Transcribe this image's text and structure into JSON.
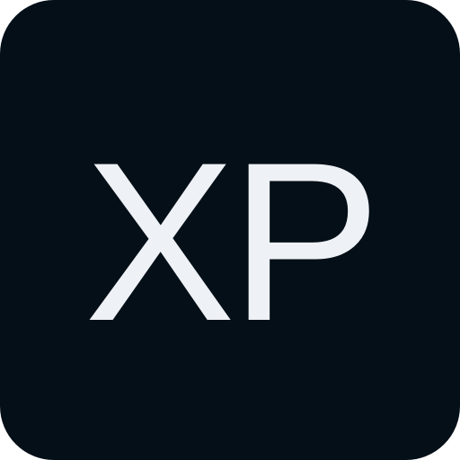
{
  "app_icon": {
    "text": "XP",
    "background_color": "#050f18",
    "text_color": "#eef1f5"
  }
}
